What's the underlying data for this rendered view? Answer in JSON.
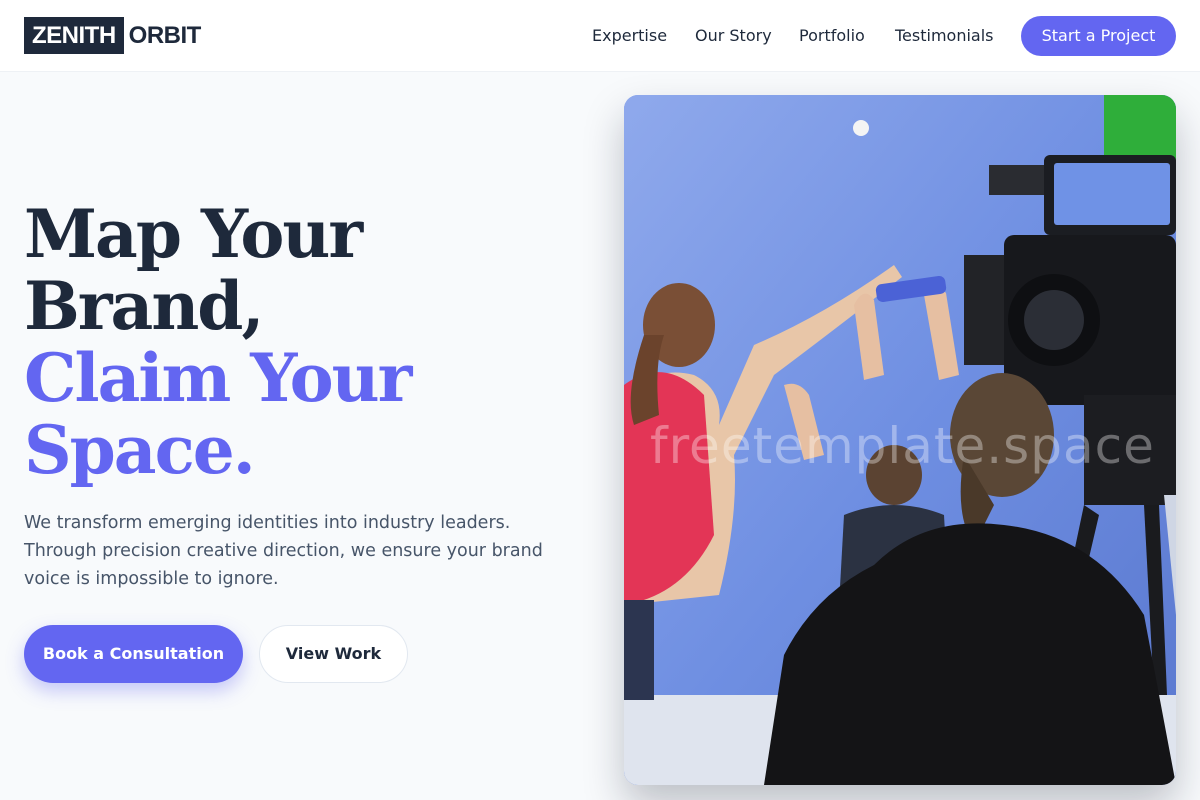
{
  "brand": {
    "logo_box": "ZENITH",
    "logo_rest": "ORBIT"
  },
  "nav": {
    "links": [
      "Expertise",
      "Our Story",
      "Portfolio",
      "Testimonials"
    ],
    "cta": "Start a Project"
  },
  "hero": {
    "headline_line1": "Map Your",
    "headline_line2": "Brand,",
    "headline_line3": "Claim Your",
    "headline_line4": "Space.",
    "subtext": "We transform emerging identities into industry leaders. Through precision creative direction, we ensure your brand voice is impossible to ignore.",
    "primary_button": "Book a Consultation",
    "secondary_button": "View Work"
  },
  "image": {
    "watermark": "freetemplate.space"
  },
  "colors": {
    "accent": "#6366f1",
    "dark": "#1e293b",
    "muted": "#475569",
    "background": "#f8fafc"
  }
}
